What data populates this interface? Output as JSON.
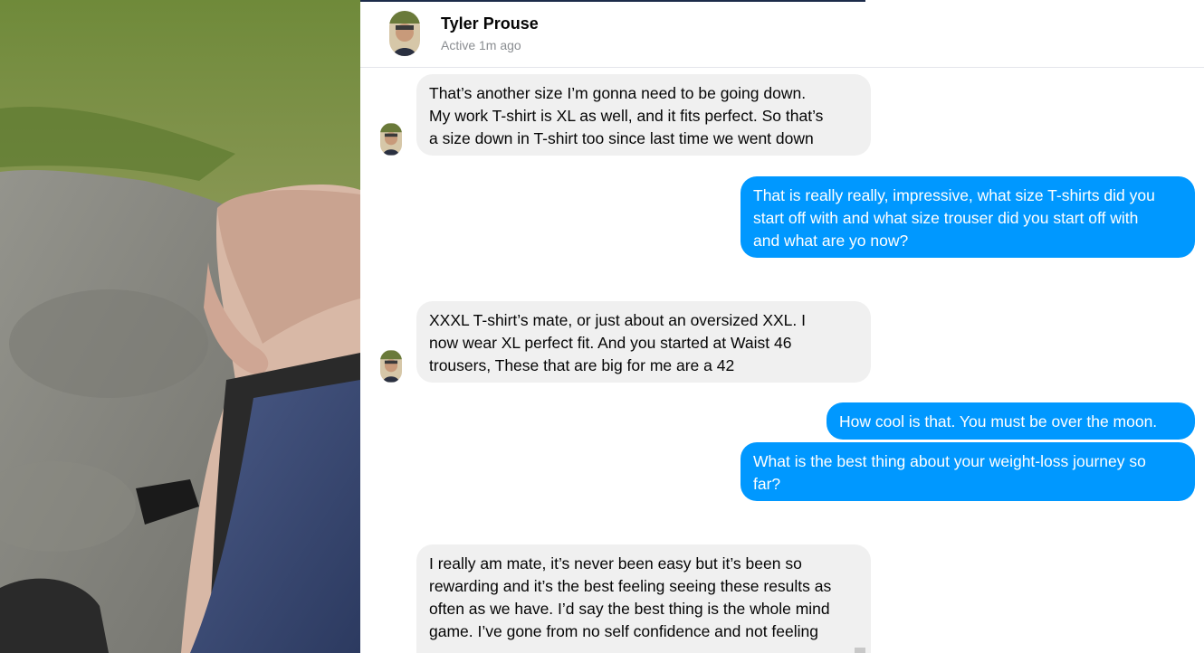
{
  "contact": {
    "name": "Tyler Prouse",
    "status": "Active 1m ago"
  },
  "messages": [
    {
      "direction": "in",
      "lines": [
        "That’s another size I’m gonna need to be going down.",
        "My work T-shirt is XL as well, and it fits perfect. So that’s",
        "a size down in T-shirt too since last time we went down"
      ]
    },
    {
      "direction": "out",
      "lines": [
        "That is really really, impressive, what size T-shirts did you",
        "start off with and what size trouser did you start off with",
        "and what are yo now?"
      ]
    },
    {
      "direction": "in",
      "lines": [
        "XXXL T-shirt’s mate, or just about an oversized XXL. I",
        "now wear XL perfect fit. And you started at Waist 46",
        "trousers, These that are big for me are a 42"
      ]
    },
    {
      "direction": "out",
      "lines": [
        "How cool is that. You must be over the moon."
      ]
    },
    {
      "direction": "out",
      "lines": [
        "What is the best thing about your weight-loss journey so",
        "far?"
      ]
    },
    {
      "direction": "in",
      "lines": [
        "I really am mate, it’s never been easy but it’s been so",
        "rewarding and it’s the best feeling seeing these results as",
        "often as we have. I’d say the best thing is the whole mind",
        "game. I’ve gone from no self confidence and not feeling"
      ]
    }
  ],
  "colors": {
    "incoming_bubble": "#f0f0f0",
    "outgoing_bubble": "#0098ff",
    "header_accent": "#1c2b4a"
  },
  "icons": {
    "avatar": "profile-photo",
    "background_photo": "photo-of-man-holding-trousers"
  }
}
